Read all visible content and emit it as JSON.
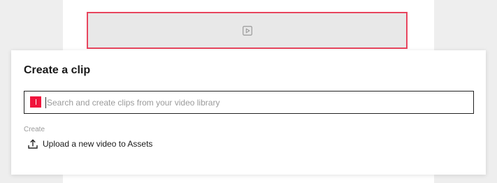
{
  "modal": {
    "title": "Create a clip",
    "search": {
      "placeholder": "Search and create clips from your video library",
      "value": ""
    },
    "create_section": {
      "label": "Create",
      "items": [
        {
          "label": "Upload a new video to Assets",
          "icon": "upload-icon"
        }
      ]
    }
  },
  "colors": {
    "accent": "#f0143c",
    "selection_outline": "#e8455e"
  }
}
